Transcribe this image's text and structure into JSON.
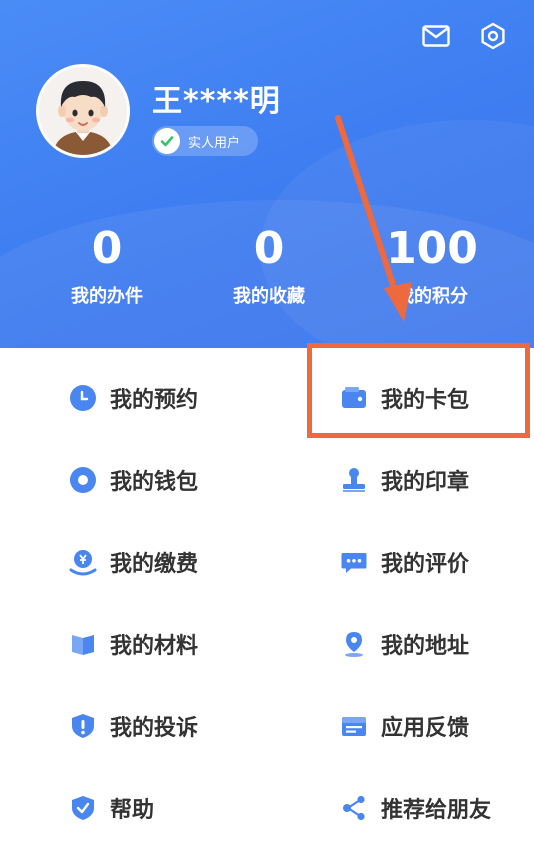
{
  "header": {
    "username": "王****明",
    "verify_badge": "实人用户",
    "icons": {
      "mail": "mail-icon",
      "settings": "settings-icon"
    },
    "stats": [
      {
        "value": "0",
        "label": "我的办件"
      },
      {
        "value": "0",
        "label": "我的收藏"
      },
      {
        "value": "100",
        "label": "我的积分"
      }
    ]
  },
  "menu": {
    "left": [
      {
        "label": "我的预约",
        "icon": "clock-icon"
      },
      {
        "label": "我的钱包",
        "icon": "wallet-coin-icon"
      },
      {
        "label": "我的缴费",
        "icon": "payment-icon"
      },
      {
        "label": "我的材料",
        "icon": "book-icon"
      },
      {
        "label": "我的投诉",
        "icon": "complaint-icon"
      },
      {
        "label": "帮助",
        "icon": "shield-icon"
      }
    ],
    "right": [
      {
        "label": "我的卡包",
        "icon": "card-wallet-icon"
      },
      {
        "label": "我的印章",
        "icon": "stamp-icon"
      },
      {
        "label": "我的评价",
        "icon": "comment-icon"
      },
      {
        "label": "我的地址",
        "icon": "location-icon"
      },
      {
        "label": "应用反馈",
        "icon": "feedback-icon"
      },
      {
        "label": "推荐给朋友",
        "icon": "share-icon"
      }
    ]
  },
  "colors": {
    "header_blue": "#3f7ff2",
    "icon_blue": "#4a86f0",
    "annotation_orange": "#ee6a3e",
    "menu_text": "#333333"
  }
}
